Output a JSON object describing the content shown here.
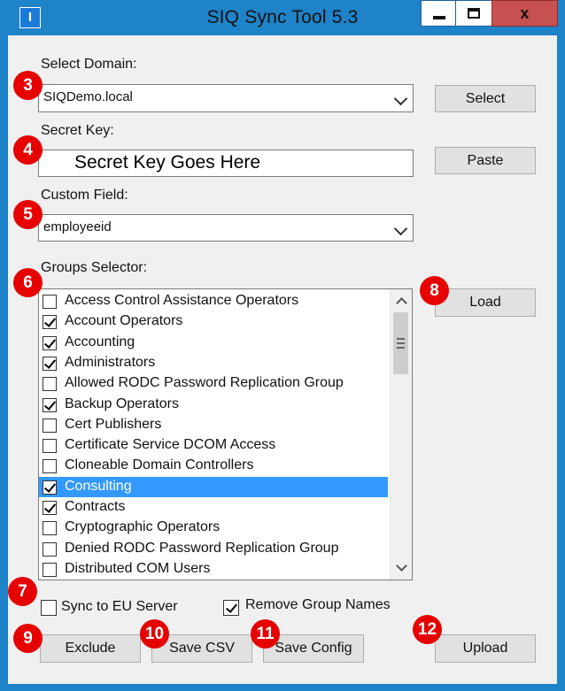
{
  "window": {
    "title": "SIQ Sync Tool 5.3",
    "app_icon_glyph": "I",
    "close_glyph": "x",
    "accent_color": "#1e83c9"
  },
  "domain": {
    "label": "Select Domain:",
    "value": "SIQDemo.local",
    "button": "Select"
  },
  "secret": {
    "label": "Secret Key:",
    "value": "Secret Key Goes Here",
    "button": "Paste"
  },
  "custom_field": {
    "label": "Custom Field:",
    "value": "employeeid"
  },
  "groups": {
    "label": "Groups Selector:",
    "load_button": "Load",
    "items": [
      {
        "name": "Access Control Assistance Operators",
        "checked": false,
        "selected": false
      },
      {
        "name": "Account Operators",
        "checked": true,
        "selected": false
      },
      {
        "name": "Accounting",
        "checked": true,
        "selected": false
      },
      {
        "name": "Administrators",
        "checked": true,
        "selected": false
      },
      {
        "name": "Allowed RODC Password Replication Group",
        "checked": false,
        "selected": false
      },
      {
        "name": "Backup Operators",
        "checked": true,
        "selected": false
      },
      {
        "name": "Cert Publishers",
        "checked": false,
        "selected": false
      },
      {
        "name": "Certificate Service DCOM Access",
        "checked": false,
        "selected": false
      },
      {
        "name": "Cloneable Domain Controllers",
        "checked": false,
        "selected": false
      },
      {
        "name": "Consulting",
        "checked": true,
        "selected": true
      },
      {
        "name": "Contracts",
        "checked": true,
        "selected": false
      },
      {
        "name": "Cryptographic Operators",
        "checked": false,
        "selected": false
      },
      {
        "name": "Denied RODC Password Replication Group",
        "checked": false,
        "selected": false
      },
      {
        "name": "Distributed COM Users",
        "checked": false,
        "selected": false
      }
    ]
  },
  "options": {
    "sync_eu": {
      "label": "Sync to EU Server",
      "checked": false
    },
    "remove_group_names": {
      "label": "Remove Group Names",
      "checked": true
    }
  },
  "actions": {
    "exclude": "Exclude",
    "save_csv": "Save CSV",
    "save_config": "Save Config",
    "upload": "Upload"
  },
  "callouts": {
    "n3": "3",
    "n4": "4",
    "n5": "5",
    "n6": "6",
    "n7": "7",
    "n8": "8",
    "n9": "9",
    "n10": "10",
    "n11": "11",
    "n12": "12",
    "color": "#e60000"
  }
}
